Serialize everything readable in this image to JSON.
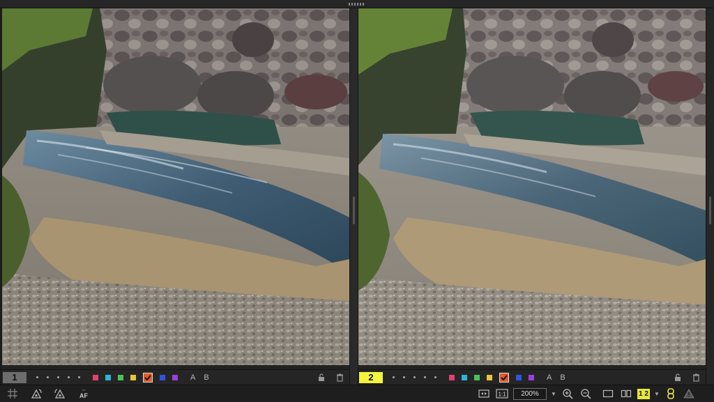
{
  "viewer": {
    "left_pane": {
      "number": "1",
      "label_a": "A",
      "label_b": "B"
    },
    "right_pane": {
      "number": "2",
      "label_a": "A",
      "label_b": "B"
    },
    "color_labels": [
      "#e0426f",
      "#2bb5d8",
      "#48c35a",
      "#e8c53a",
      "#e25a24",
      "#2f55e0",
      "#9a3fe0"
    ]
  },
  "toolbar": {
    "af_label": "AF",
    "zoom_value": "200%",
    "page_indicator": "1 2"
  },
  "icons": {
    "grid": "grid-icon",
    "rotate_left": "rotate-left-icon",
    "rotate_right": "rotate-right-icon",
    "lock": "lock-icon",
    "trash": "trash-icon",
    "fit": "fit-screen-icon",
    "actual": "actual-size-icon",
    "zoom_in": "zoom-in-icon",
    "zoom_out": "zoom-out-icon",
    "single": "single-view-icon",
    "dual": "dual-view-icon",
    "sync": "sync-link-icon",
    "warn": "warning-icon"
  }
}
